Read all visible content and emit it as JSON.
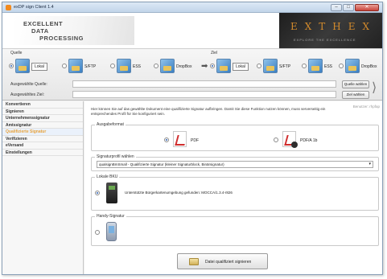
{
  "window": {
    "title": "exDP sign Client 1.4"
  },
  "banner": {
    "logo_lines": [
      "EXCELLENT",
      "DATA",
      "PROCESSING"
    ],
    "brand": "EXTHEX",
    "tagline": "EXPLORE THE EXCELLENCE"
  },
  "source": {
    "label": "Quelle",
    "options": [
      {
        "label": "Lokal",
        "selected": true
      },
      {
        "label": "S/FTP",
        "selected": false
      },
      {
        "label": "ESS",
        "selected": false
      },
      {
        "label": "DropBox",
        "selected": false
      }
    ]
  },
  "target": {
    "label": "Ziel",
    "options": [
      {
        "label": "Lokal",
        "selected": true
      },
      {
        "label": "S/FTP",
        "selected": false
      },
      {
        "label": "ESS",
        "selected": false
      },
      {
        "label": "DropBox",
        "selected": false
      }
    ]
  },
  "fields": {
    "source_label": "Ausgewählte Quelle:",
    "source_value": "",
    "source_button": "Quelle wählen",
    "target_label": "Ausgewähltes Ziel:",
    "target_value": "",
    "target_button": "Ziel wählen"
  },
  "sidebar": {
    "items": [
      {
        "label": "Konvertieren",
        "active": false
      },
      {
        "label": "Signieren",
        "active": false
      },
      {
        "label": "Unternehmenssignatur",
        "active": false
      },
      {
        "label": "Amtssignatur",
        "active": false
      },
      {
        "label": "Qualifizierte Signatur",
        "active": true
      },
      {
        "label": "Verifizieren",
        "active": false
      },
      {
        "label": "eVersand",
        "active": false
      },
      {
        "label": "Einstellungen",
        "active": false
      }
    ]
  },
  "main": {
    "user_label": "Benutzer: rhpfap",
    "intro": "Hier können Sie auf das gewählte Dokument eine qualifizierte Signatur aufbringen. Damit Sie diese Funktion nutzen können, muss serverseitig ein entsprechendes Profil für Sie konfiguriert sein.",
    "output_format": {
      "legend": "Ausgabeformat",
      "options": [
        {
          "label": "PDF",
          "selected": true
        },
        {
          "label": "PDF/A 1b",
          "selected": false
        }
      ]
    },
    "profile": {
      "legend": "Signaturprofil wählen",
      "selected": "qualsignBmSmall - Qualifizierte Signatur (kleiner Signaturblock, Binärsignatur)"
    },
    "local_bku": {
      "legend": "Lokale BKU",
      "selected": true,
      "text": "Unterstützte Bürgerkartenumgebung gefunden: MOCCA/1.3.4-r826"
    },
    "handy": {
      "legend": "Handy-Signatur",
      "selected": false
    },
    "sign_button": "Datei qualifiziert signieren"
  },
  "colors": {
    "accent": "#e8a23a",
    "brand": "#d28a2c",
    "selection": "#2a5db0"
  },
  "icons": {
    "app": "app-icon",
    "source_options": "folder-icon",
    "arrow": "arrow-right-icon",
    "pdf": "pdf-icon",
    "pdfa": "pdfa-icon",
    "bku": "card-reader-icon",
    "handy": "phone-icon",
    "sign": "signature-icon",
    "refresh": "refresh-icon"
  }
}
